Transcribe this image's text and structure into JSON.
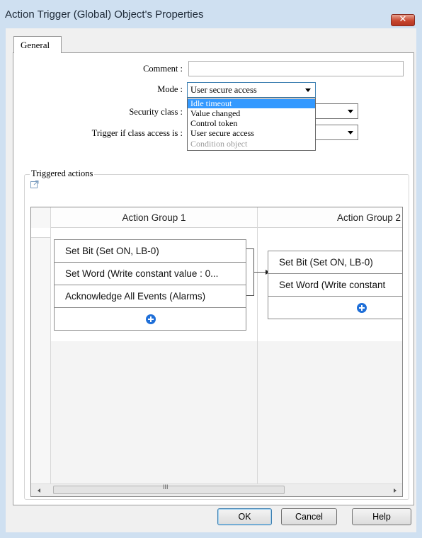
{
  "window": {
    "title": "Action Trigger (Global) Object's Properties",
    "close_glyph": "✕"
  },
  "tabs": [
    {
      "label": "General",
      "active": true
    }
  ],
  "form": {
    "comment_label": "Comment :",
    "comment_value": "",
    "mode_label": "Mode :",
    "mode_value": "User secure access",
    "security_class_label": "Security class :",
    "security_class_value": "",
    "trigger_label": "Trigger if class access is :",
    "trigger_value": ""
  },
  "mode_dropdown": {
    "options": [
      {
        "label": "Idle timeout",
        "state": "highlighted"
      },
      {
        "label": "Value changed",
        "state": "normal"
      },
      {
        "label": "Control token",
        "state": "normal"
      },
      {
        "label": "User secure access",
        "state": "normal"
      },
      {
        "label": "Condition object",
        "state": "disabled"
      }
    ]
  },
  "triggered_actions": {
    "legend": "Triggered actions",
    "groups": [
      {
        "title": "Action Group 1",
        "actions": [
          "Set Bit (Set ON, LB-0)",
          "Set Word (Write constant value : 0...",
          "Acknowledge All Events (Alarms)"
        ]
      },
      {
        "title": "Action Group 2",
        "actions": [
          "Set Bit (Set ON, LB-0)",
          "Set Word (Write constant"
        ]
      }
    ],
    "scrollbar_thumb_grip": "III"
  },
  "buttons": {
    "ok": "OK",
    "cancel": "Cancel",
    "help": "Help"
  },
  "colors": {
    "selection": "#3399ff",
    "add_icon": "#1f6fd8",
    "close_button": "#c8462f"
  },
  "icons": [
    "close-icon",
    "combo-arrow-icon",
    "popout-icon",
    "add-icon",
    "connector-arrow-icon"
  ]
}
